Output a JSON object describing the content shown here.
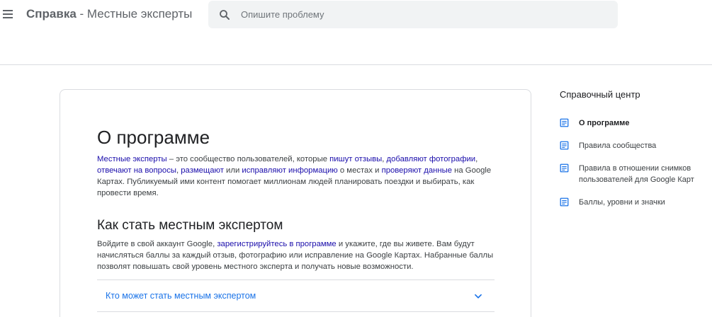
{
  "header": {
    "title_strong": "Справка",
    "title_rest": " - Местные эксперты",
    "search_placeholder": "Опишите проблему",
    "search_value": ""
  },
  "article": {
    "title": "О программе",
    "intro": {
      "link_local_guides": "Местные эксперты",
      "t1": " – это сообщество пользователей, которые ",
      "link_reviews": "пишут отзывы",
      "t2": ", ",
      "link_photos": "добавляют фотографии",
      "t3": ", ",
      "link_answer": "отвечают на вопросы",
      "t4": ", ",
      "link_place": "размещают",
      "t5": " или ",
      "link_fix": "исправляют информацию",
      "t6": " о местах и ",
      "link_check": "проверяют данные",
      "t7": " на Google Картах. Публикуемый ими контент помогает миллионам людей планировать поездки и выбирать, как провести время."
    },
    "section_title": "Как стать местным экспертом",
    "howto": {
      "t1": "Войдите в свой аккаунт Google, ",
      "link_register": "зарегистрируйтесь в программе",
      "t2": " и укажите, где вы живете. Вам будут начисляться баллы за каждый отзыв, фотографию или исправление на Google Картах. Набранные баллы позволят повышать свой уровень местного эксперта и получать новые возможности."
    },
    "accordion_label": "Кто может стать местным экспертом"
  },
  "sidebar": {
    "title": "Справочный центр",
    "items": [
      {
        "label": "О программе",
        "icon": "article-icon",
        "active": true
      },
      {
        "label": "Правила сообщества",
        "icon": "article-icon",
        "active": false
      },
      {
        "label": "Правила в отношении снимков пользователей для Google Карт",
        "icon": "article-icon",
        "active": false
      },
      {
        "label": "Баллы, уровни и значки",
        "icon": "article-icon",
        "active": false
      }
    ]
  },
  "colors": {
    "link": "#1a0dab",
    "accent": "#1a73e8",
    "icon": "#1a73e8",
    "search_bg": "#f1f3f4",
    "divider": "#dadce0"
  }
}
